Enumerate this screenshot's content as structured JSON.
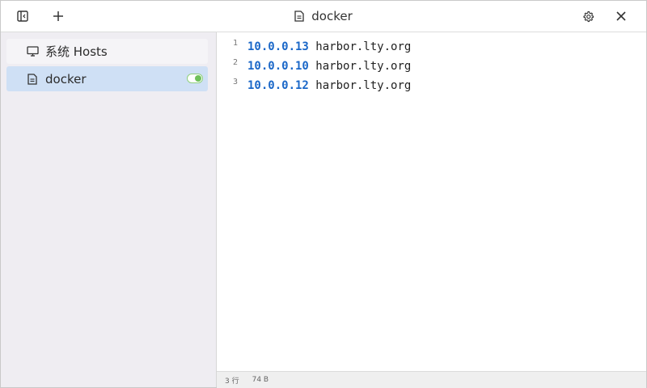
{
  "window": {
    "title": "docker",
    "icons": {
      "sidebar_toggle": "sidebar-toggle-icon",
      "add": "plus-icon",
      "settings": "gear-icon",
      "close": "close-icon",
      "title_file": "file-icon"
    }
  },
  "sidebar": {
    "items": [
      {
        "label": "系统 Hosts",
        "icon": "monitor-icon",
        "active": false,
        "toggle": null
      },
      {
        "label": "docker",
        "icon": "file-icon",
        "active": true,
        "toggle": "on"
      }
    ]
  },
  "editor": {
    "lines": [
      {
        "num": "1",
        "ip": "10.0.0.13",
        "host": "harbor.lty.org"
      },
      {
        "num": "2",
        "ip": "10.0.0.10",
        "host": "harbor.lty.org"
      },
      {
        "num": "3",
        "ip": "10.0.0.12",
        "host": "harbor.lty.org"
      }
    ]
  },
  "status": {
    "lines": "3 行",
    "size": "74 B"
  },
  "colors": {
    "ip": "#1a67c8",
    "active_item": "#cfe0f5",
    "toggle_on": "#6fc15a",
    "sidebar_bg": "#efedf2"
  }
}
